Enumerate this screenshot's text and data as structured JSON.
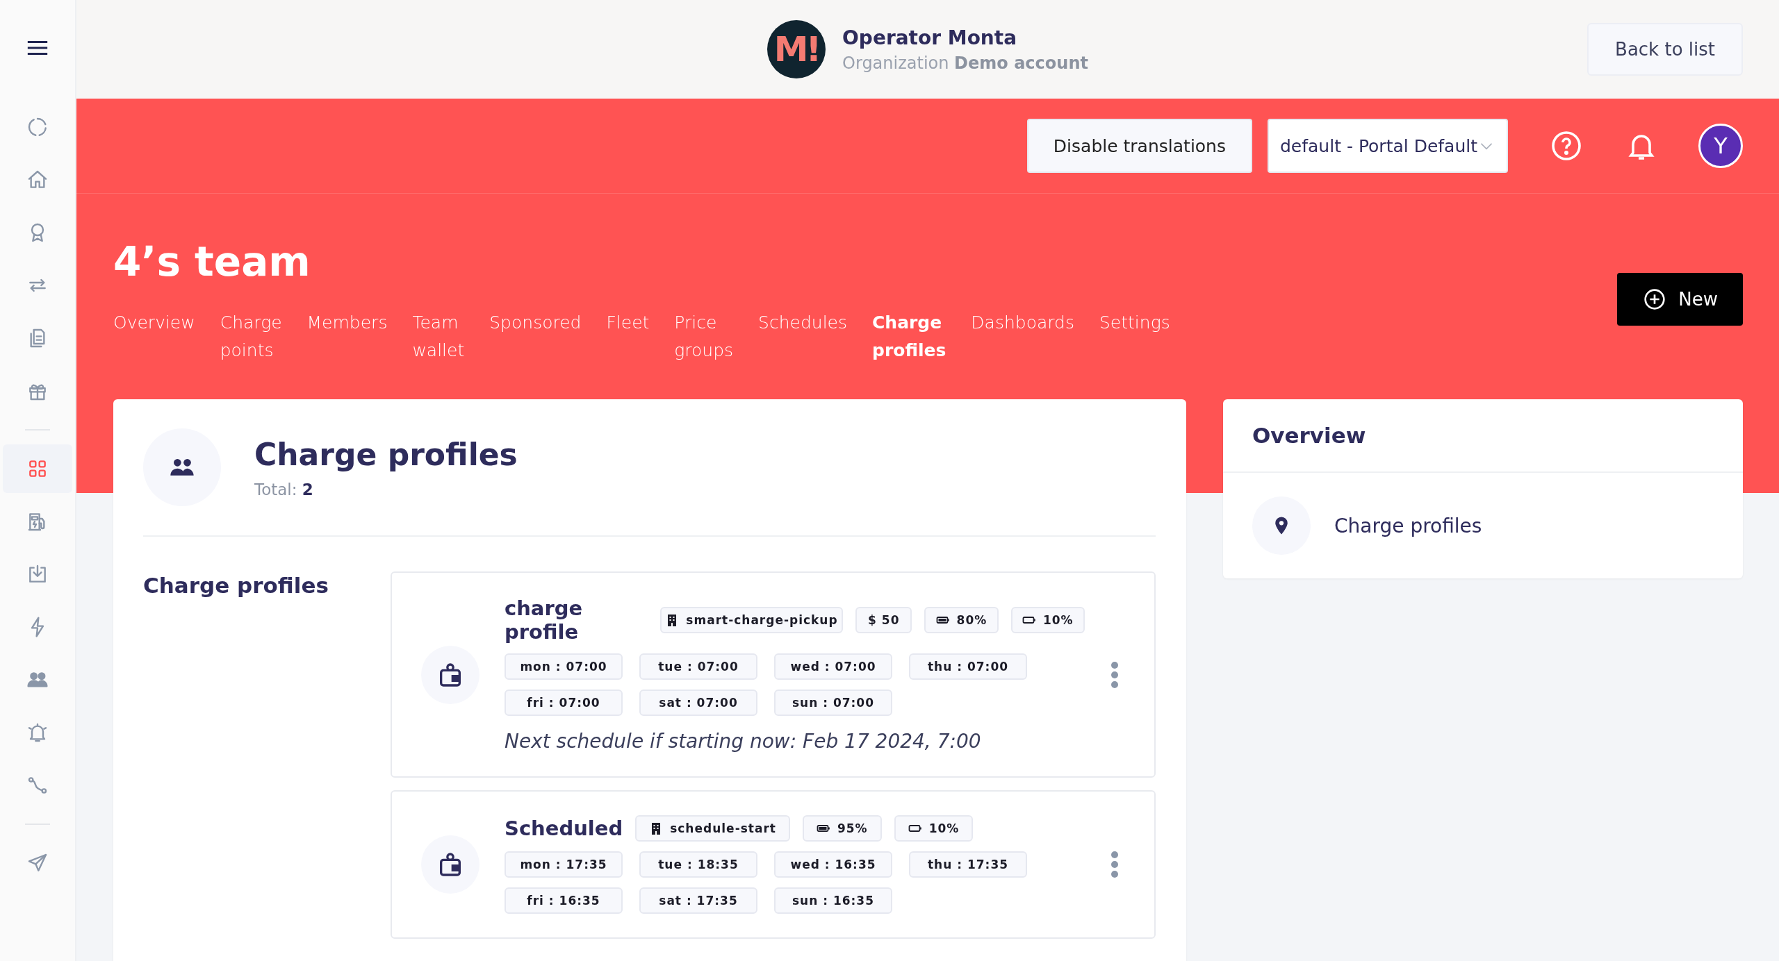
{
  "sidebar": {
    "groups": [
      [
        {
          "selected": false
        },
        {
          "selected": false
        },
        {
          "selected": false
        },
        {
          "selected": false
        },
        {
          "selected": false
        },
        {
          "selected": false
        }
      ],
      [
        {
          "selected": true
        },
        {
          "selected": false
        },
        {
          "selected": false
        },
        {
          "selected": false
        },
        {
          "selected": false
        },
        {
          "selected": false
        },
        {
          "selected": false
        }
      ],
      [
        {
          "selected": false
        }
      ]
    ]
  },
  "header": {
    "logo": "M!",
    "operator": "Operator Monta",
    "organization": "Organization **Demo account**",
    "back_button": "Back to list"
  },
  "toolbar": {
    "translations_button": "Disable translations",
    "language_select": "default - Portal Default",
    "avatar": "Y"
  },
  "team": {
    "title": "4’s team",
    "new_button": "New",
    "tabs": [
      {
        "label": "Overview",
        "selected": false
      },
      {
        "label": "Charge points",
        "selected": false
      },
      {
        "label": "Members",
        "selected": false
      },
      {
        "label": "Team wallet",
        "selected": false
      },
      {
        "label": "Sponsored",
        "selected": false
      },
      {
        "label": "Fleet",
        "selected": false
      },
      {
        "label": "Price groups",
        "selected": false
      },
      {
        "label": "Schedules",
        "selected": false
      },
      {
        "label": "Charge profiles",
        "selected": true
      },
      {
        "label": "Dashboards",
        "selected": false
      },
      {
        "label": "Settings",
        "selected": false
      }
    ]
  },
  "main": {
    "title": "Charge profiles",
    "total_label": "Total:",
    "total": "2",
    "section_label": "Charge profiles",
    "profiles": [
      {
        "name": "charge profile",
        "tags": [
          {
            "kind": "building",
            "text": "smart-charge-pickup"
          },
          {
            "kind": "price",
            "text": "$ 50"
          },
          {
            "kind": "battery-full",
            "text": "80%"
          },
          {
            "kind": "battery-low",
            "text": "10%"
          }
        ],
        "schedule": [
          "mon : 07:00",
          "tue : 07:00",
          "wed : 07:00",
          "thu : 07:00",
          "fri : 07:00",
          "sat : 07:00",
          "sun : 07:00"
        ],
        "next": "Next schedule if starting now: Feb 17 2024, 7:00"
      },
      {
        "name": "Scheduled",
        "tags": [
          {
            "kind": "building",
            "text": "schedule-start"
          },
          {
            "kind": "battery-full",
            "text": "95%"
          },
          {
            "kind": "battery-low",
            "text": "10%"
          }
        ],
        "schedule": [
          "mon : 17:35",
          "tue : 18:35",
          "wed : 16:35",
          "thu : 17:35",
          "fri : 16:35",
          "sat : 17:35",
          "sun : 16:35"
        ]
      }
    ]
  },
  "overview": {
    "title": "Overview",
    "items": [
      {
        "label": "Charge profiles"
      }
    ]
  }
}
